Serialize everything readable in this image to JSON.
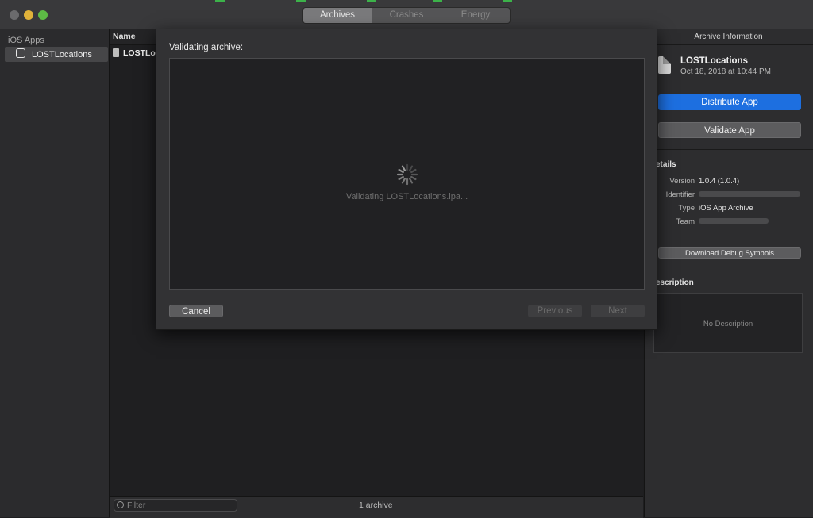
{
  "window": {
    "tabs": [
      {
        "label": "Archives",
        "active": true
      },
      {
        "label": "Crashes",
        "active": false
      },
      {
        "label": "Energy",
        "active": false
      }
    ],
    "traffic_lights": {
      "close": "#ec5f57",
      "minimize": "#e0b23a",
      "zoom": "#5dbb45"
    }
  },
  "sidebar": {
    "section_title": "iOS Apps",
    "items": [
      {
        "label": "LOSTLocations",
        "icon": "app-icon",
        "selected": true
      }
    ]
  },
  "list": {
    "column_name": "Name",
    "rows": [
      {
        "label": "LOSTLoc",
        "icon": "document-icon"
      }
    ],
    "filter_placeholder": "Filter",
    "count_text": "1 archive"
  },
  "sheet": {
    "title": "Validating archive:",
    "status": "Validating LOSTLocations.ipa...",
    "cancel_label": "Cancel",
    "previous_label": "Previous",
    "next_label": "Next"
  },
  "info_panel": {
    "title": "Archive Information",
    "archive_name": "LOSTLocations",
    "archive_date": "Oct 18, 2018 at 10:44 PM",
    "distribute_label": "Distribute App",
    "validate_label": "Validate App",
    "details_heading": "etails",
    "details": {
      "version_label": "Version",
      "version_value": "1.0.4 (1.0.4)",
      "identifier_label": "Identifier",
      "type_label": "Type",
      "type_value": "iOS App Archive",
      "team_label": "Team"
    },
    "debug_symbols_label": "Download Debug Symbols",
    "description_heading": "escription",
    "description_text": "No Description"
  },
  "colors": {
    "accent": "#1d6fe0"
  }
}
